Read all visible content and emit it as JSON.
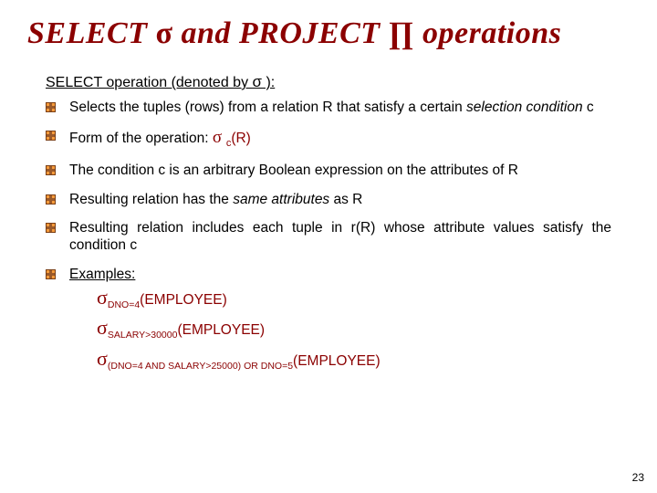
{
  "title": {
    "part1": "SELECT ",
    "sigma": "σ",
    "part2": " and PROJECT ",
    "pi": "∏",
    "part3": " operations"
  },
  "subhead": {
    "pre": "SELECT operation (denoted by ",
    "sigma": "σ",
    "post": " ):"
  },
  "bullets": {
    "b1": {
      "pre": "Selects the tuples (rows) from a relation R that satisfy a certain ",
      "em": "selection condition",
      "post": "  c"
    },
    "b2": {
      "pre": "Form of the operation: ",
      "sigma": "σ ",
      "sub": "c",
      "arg": "(R)"
    },
    "b3": "The condition c is an arbitrary Boolean expression on the attributes of R",
    "b4": {
      "pre": "Resulting relation has the ",
      "em": "same attributes",
      "post": "  as R"
    },
    "b5": "Resulting relation includes each tuple in r(R) whose attribute values satisfy the condition c",
    "b6": {
      "label": "Examples:",
      "ex1": {
        "sigma": "σ",
        "cond": "DNO=4",
        "arg": "(EMPLOYEE)"
      },
      "ex2": {
        "sigma": "σ",
        "cond": "SALARY>30000",
        "arg": "(EMPLOYEE)"
      },
      "ex3": {
        "sigma": "σ",
        "cond": "(DNO=4 AND SALARY>25000) OR DNO=5",
        "arg": "(EMPLOYEE)"
      }
    }
  },
  "page_number": "23"
}
